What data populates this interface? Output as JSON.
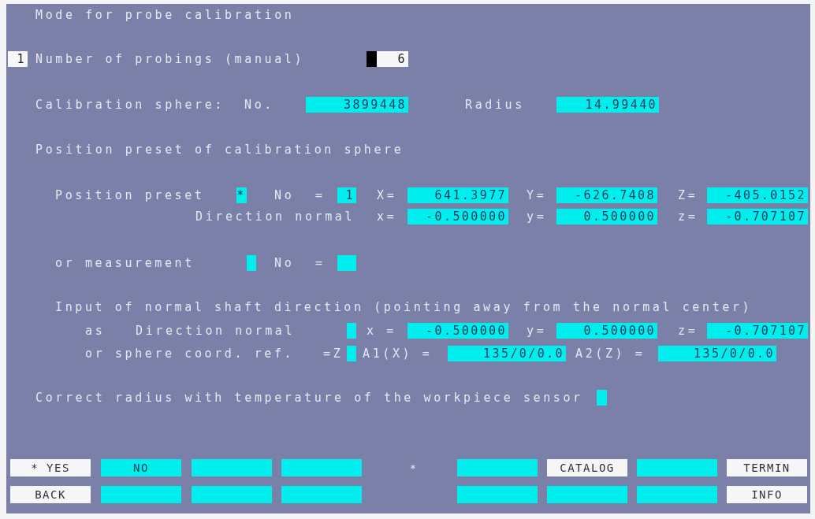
{
  "title": "Mode for probe calibration",
  "probings": {
    "marker": "1",
    "label": "Number of probings (manual)",
    "value": "6"
  },
  "sphere": {
    "label": "Calibration sphere:",
    "number_label": "No.",
    "number": "3899448",
    "radius_label": "Radius",
    "radius": "14.99440"
  },
  "position_heading": "Position preset of calibration sphere",
  "preset": {
    "label": "Position preset",
    "selected": true,
    "marker": "*",
    "no_label": "No",
    "equals": "=",
    "no": "1",
    "coords": [
      {
        "label": "X=",
        "value": "641.3977"
      },
      {
        "label": "Y=",
        "value": "-626.7408"
      },
      {
        "label": "Z=",
        "value": "-405.0152"
      }
    ]
  },
  "preset_direction": {
    "label": "Direction normal",
    "coords": [
      {
        "label": "x=",
        "value": "-0.500000"
      },
      {
        "label": "y=",
        "value": "0.500000"
      },
      {
        "label": "z=",
        "value": "-0.707107"
      }
    ]
  },
  "measurement": {
    "label": "or measurement",
    "selected": false,
    "no_label": "No",
    "equals": "="
  },
  "shaft_heading": "Input of normal shaft direction (pointing away from the normal center)",
  "shaft_direction": {
    "prefix": "as",
    "label": "Direction normal",
    "selected": false,
    "coords": [
      {
        "label": "x =",
        "value": "-0.500000"
      },
      {
        "label": "y=",
        "value": "0.500000"
      },
      {
        "label": "z=",
        "value": "-0.707107"
      }
    ]
  },
  "shaft_sphere": {
    "label": "or sphere coord. ref.",
    "axis": "=Z",
    "selected": false,
    "angles": [
      {
        "label": "A1(X) =",
        "value": "135/0/0.0"
      },
      {
        "label": "A2(Z) =",
        "value": "135/0/0.0"
      }
    ]
  },
  "temperature": {
    "label": "Correct radius with temperature of the workpiece sensor",
    "selected": false
  },
  "softkeys": [
    [
      {
        "kind": "white",
        "label": "* YES"
      },
      {
        "kind": "cyan",
        "label": "NO"
      },
      {
        "kind": "cyan"
      },
      {
        "kind": "cyan"
      },
      {
        "kind": "dot",
        "label": "*"
      },
      {
        "kind": "cyan"
      },
      {
        "kind": "white",
        "label": "CATALOG"
      },
      {
        "kind": "cyan"
      },
      {
        "kind": "white",
        "label": "TERMIN"
      }
    ],
    [
      {
        "kind": "white",
        "label": "BACK"
      },
      {
        "kind": "cyan"
      },
      {
        "kind": "cyan"
      },
      {
        "kind": "cyan"
      },
      {
        "kind": "gap"
      },
      {
        "kind": "cyan"
      },
      {
        "kind": "cyan"
      },
      {
        "kind": "cyan"
      },
      {
        "kind": "white",
        "label": "INFO"
      }
    ]
  ]
}
